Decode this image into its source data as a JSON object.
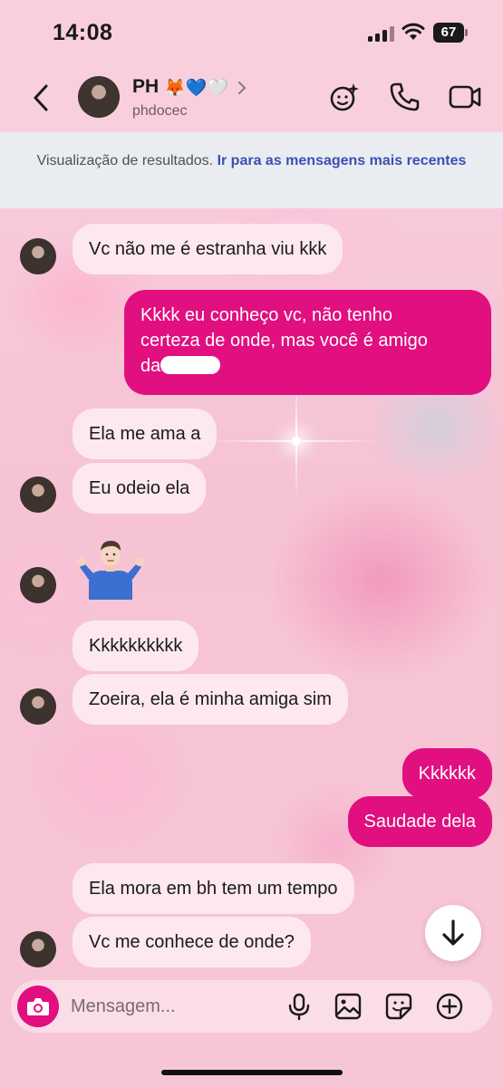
{
  "status_bar": {
    "time": "14:08",
    "battery": "67",
    "signal_icon": "cellular-signal-icon",
    "wifi_icon": "wifi-icon"
  },
  "header": {
    "contact_name": "PH",
    "contact_emojis": "🦊💙🤍",
    "username": "phdocec",
    "icons": [
      "back-icon",
      "chevron-right-icon",
      "effects-icon",
      "phone-icon",
      "video-call-icon"
    ]
  },
  "banner": {
    "text": "Visualização de resultados.",
    "link": "Ir para as mensagens mais recentes"
  },
  "messages": [
    {
      "from": "them",
      "text": "Vc não me é estranha viu kkk"
    },
    {
      "from": "me",
      "lines": [
        "Kkkk eu conheço vc, não tenho",
        "certeza de onde, mas você é amigo",
        "da"
      ]
    },
    {
      "from": "them",
      "text": "Ela me ama a"
    },
    {
      "from": "them",
      "text": "Eu odeio ela"
    },
    {
      "from": "them",
      "emoji": "🤷🏻‍♂️"
    },
    {
      "from": "them",
      "text": "Kkkkkkkkkk"
    },
    {
      "from": "them",
      "text": "Zoeira, ela é minha amiga sim"
    },
    {
      "from": "me",
      "text": "Kkkkkk"
    },
    {
      "from": "me",
      "text": "Saudade dela"
    },
    {
      "from": "them",
      "text": "Ela mora em bh tem um tempo"
    },
    {
      "from": "them",
      "text": "Vc me conhece de onde?"
    }
  ],
  "composer": {
    "placeholder": "Mensagem...",
    "icons": [
      "camera-icon",
      "microphone-icon",
      "gallery-icon",
      "sticker-icon",
      "add-icon"
    ]
  },
  "colors": {
    "outgoing_bubble": "#e10f7f",
    "incoming_bubble": "#fde8f0",
    "link": "#3d4fb3",
    "background": "#f8c9d8"
  }
}
